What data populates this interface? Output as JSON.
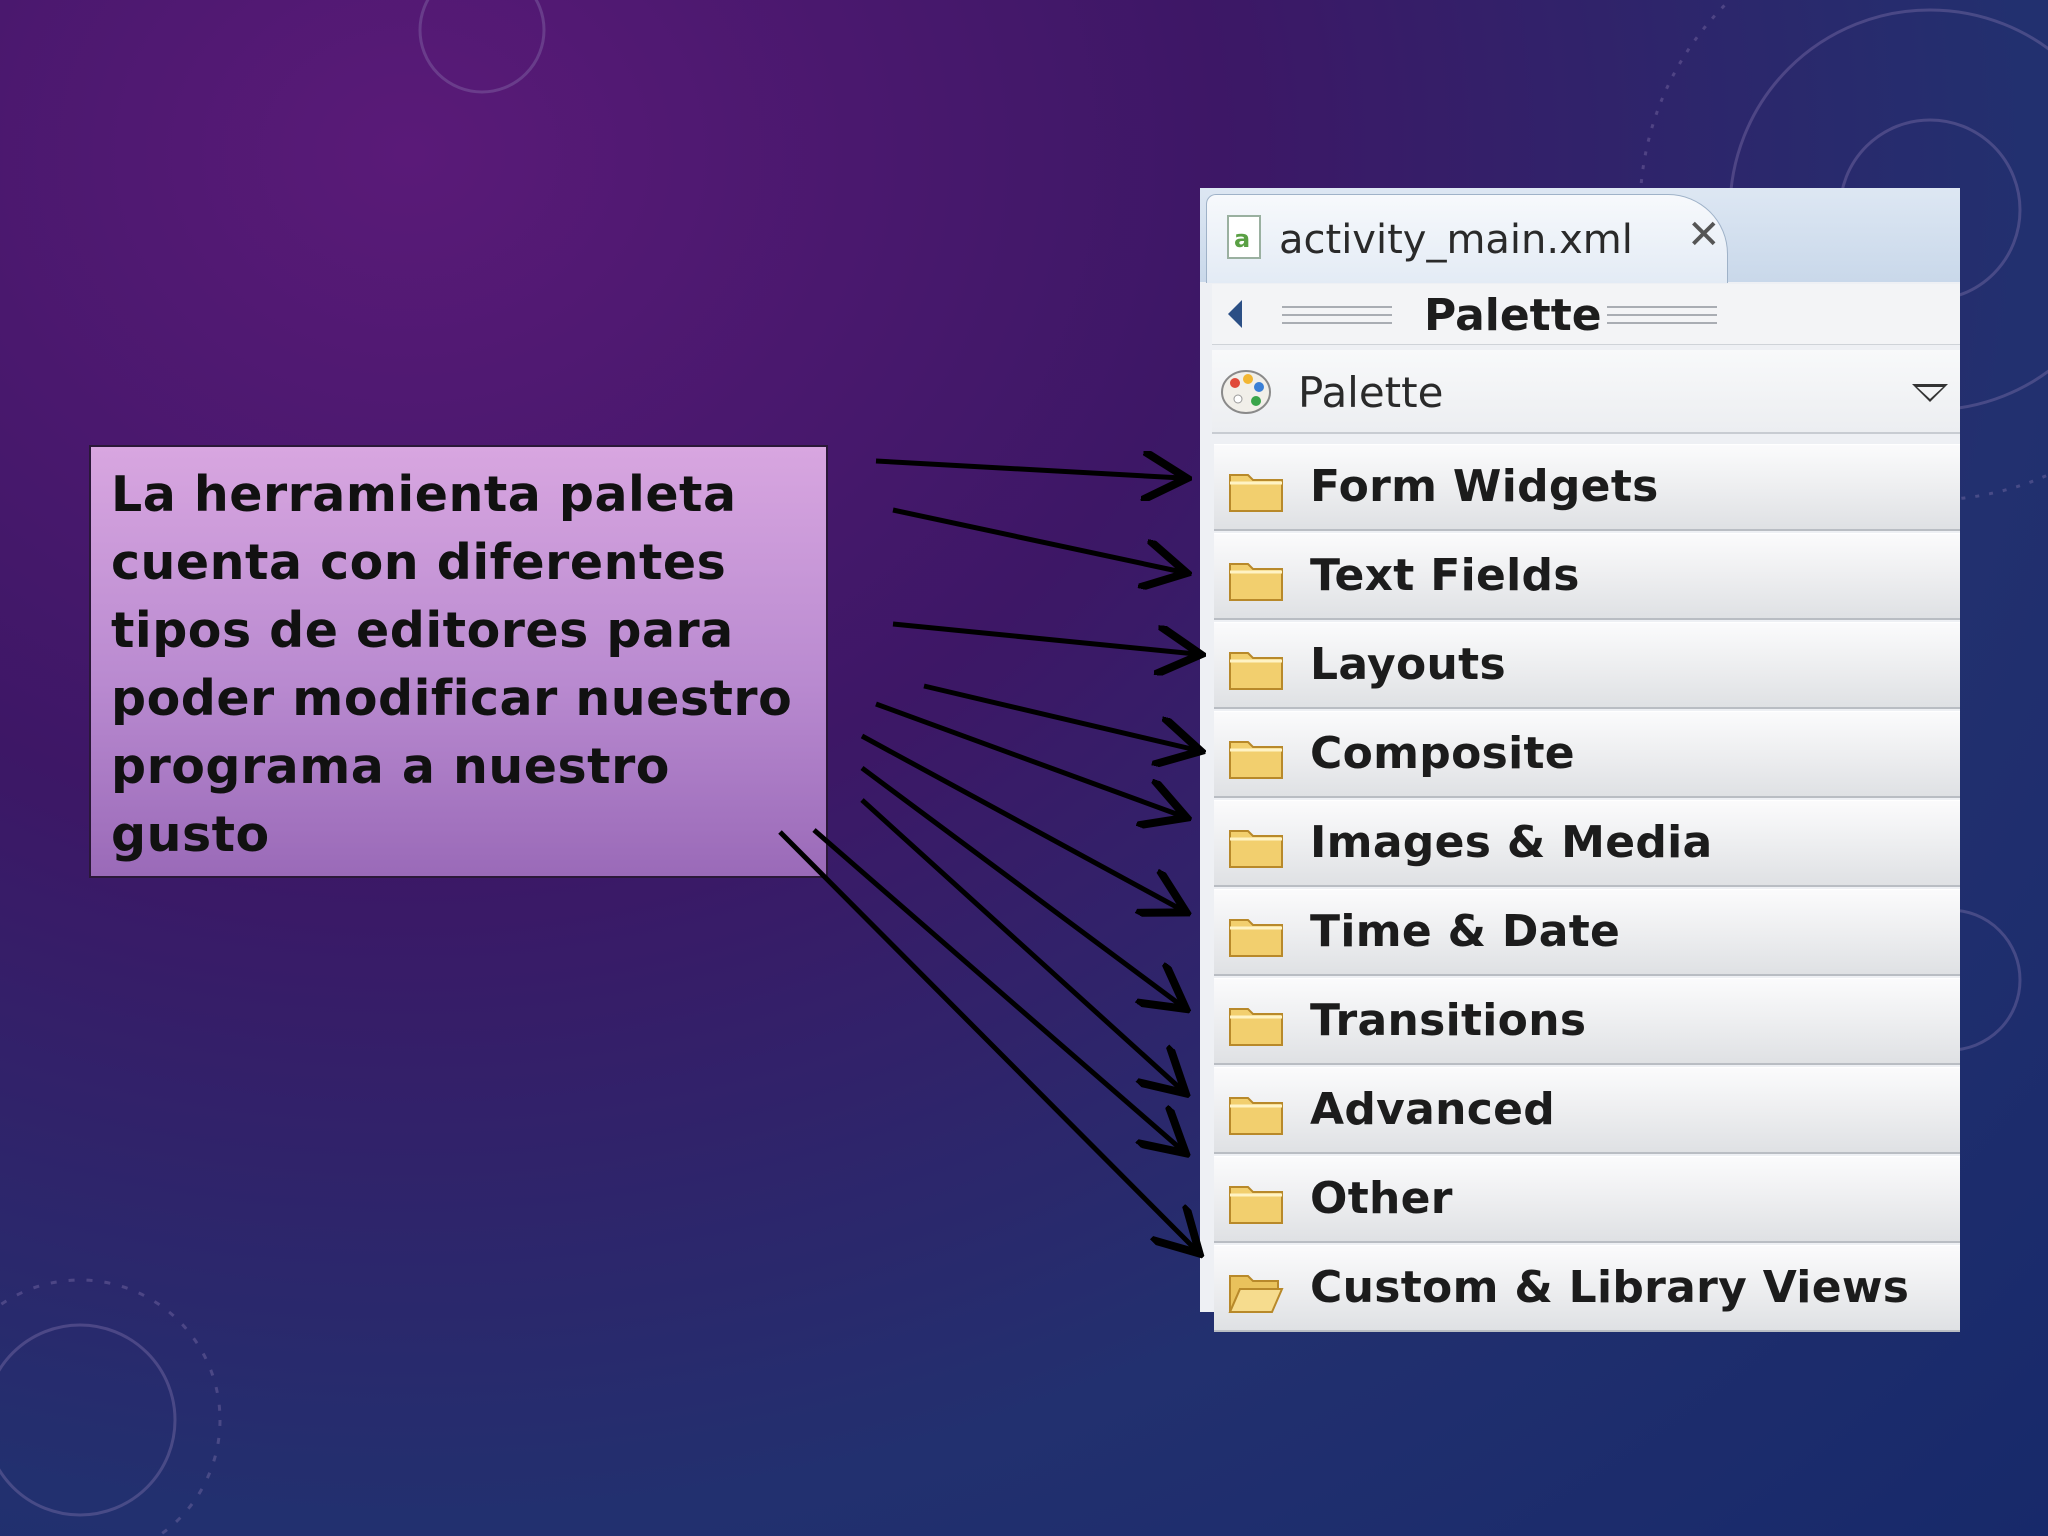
{
  "slide": {
    "callout_text": "La herramienta paleta cuenta con diferentes tipos de editores para poder modificar nuestro programa a nuestro gusto"
  },
  "editor": {
    "tab_title": "activity_main.xml",
    "close_symbol": "✕",
    "header_title": "Palette",
    "dropdown_label": "Palette"
  },
  "palette": {
    "categories": [
      {
        "label": "Form Widgets",
        "icon": "folder-icon"
      },
      {
        "label": "Text Fields",
        "icon": "folder-icon"
      },
      {
        "label": "Layouts",
        "icon": "folder-icon"
      },
      {
        "label": "Composite",
        "icon": "folder-icon"
      },
      {
        "label": "Images & Media",
        "icon": "folder-icon"
      },
      {
        "label": "Time & Date",
        "icon": "folder-icon"
      },
      {
        "label": "Transitions",
        "icon": "folder-icon"
      },
      {
        "label": "Advanced",
        "icon": "folder-icon"
      },
      {
        "label": "Other",
        "icon": "folder-icon"
      },
      {
        "label": "Custom & Library Views",
        "icon": "folder-open-icon"
      }
    ]
  },
  "colors": {
    "background_top": "#5a1a78",
    "background_bottom": "#17296a",
    "callout_fill": "#c497d8",
    "folder_yellow": "#f2cf6e"
  }
}
